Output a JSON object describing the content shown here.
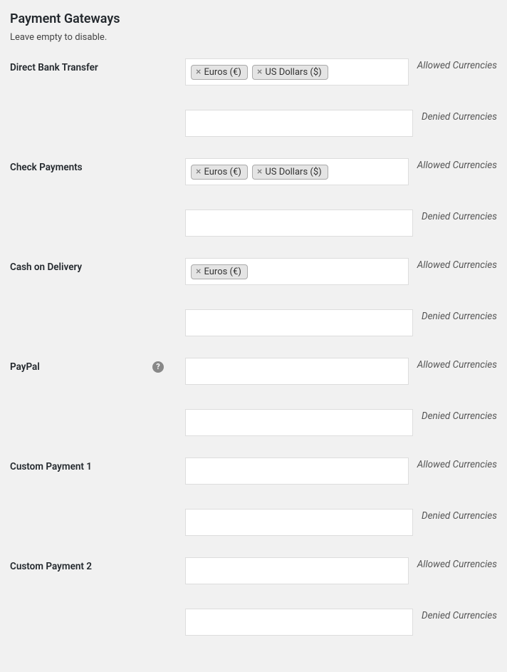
{
  "section": {
    "title": "Payment Gateways",
    "description": "Leave empty to disable."
  },
  "labels": {
    "allowed": "Allowed Currencies",
    "denied": "Denied Currencies"
  },
  "gateways": [
    {
      "name": "Direct Bank Transfer",
      "help": false,
      "allowed": [
        "Euros (€)",
        "US Dollars ($)"
      ],
      "denied": []
    },
    {
      "name": "Check Payments",
      "help": false,
      "allowed": [
        "Euros (€)",
        "US Dollars ($)"
      ],
      "denied": []
    },
    {
      "name": "Cash on Delivery",
      "help": false,
      "allowed": [
        "Euros (€)"
      ],
      "denied": []
    },
    {
      "name": "PayPal",
      "help": true,
      "allowed": [],
      "denied": []
    },
    {
      "name": "Custom Payment 1",
      "help": false,
      "allowed": [],
      "denied": []
    },
    {
      "name": "Custom Payment 2",
      "help": false,
      "allowed": [],
      "denied": []
    }
  ]
}
